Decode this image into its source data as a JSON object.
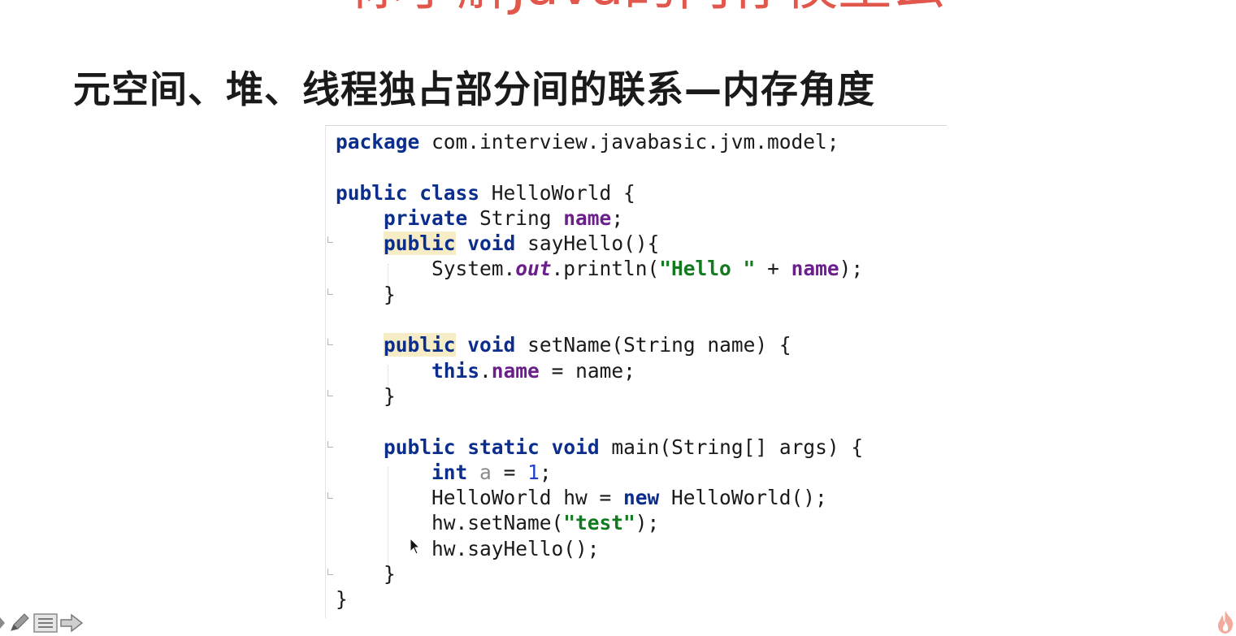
{
  "slide": {
    "title": "你了解Java的内存模型么",
    "subtitle": "元空间、堆、线程独占部分间的联系—内存角度"
  },
  "code": {
    "lines": [
      [
        {
          "t": "package",
          "c": "kw"
        },
        {
          "t": " com.interview.javabasic.jvm.model;"
        }
      ],
      [],
      [
        {
          "t": "public",
          "c": "kw"
        },
        {
          "t": " "
        },
        {
          "t": "class",
          "c": "kw"
        },
        {
          "t": " HelloWorld {"
        }
      ],
      [
        {
          "t": "    "
        },
        {
          "t": "private",
          "c": "kw"
        },
        {
          "t": " String "
        },
        {
          "t": "name",
          "c": "fld"
        },
        {
          "t": ";"
        }
      ],
      [
        {
          "t": "    "
        },
        {
          "t": "public",
          "c": "kwhl"
        },
        {
          "t": " "
        },
        {
          "t": "void",
          "c": "kw"
        },
        {
          "t": " sayHello(){"
        }
      ],
      [
        {
          "t": "        System."
        },
        {
          "t": "out",
          "c": "fldit"
        },
        {
          "t": ".println("
        },
        {
          "t": "\"Hello \"",
          "c": "str"
        },
        {
          "t": " + "
        },
        {
          "t": "name",
          "c": "fld"
        },
        {
          "t": ");"
        }
      ],
      [
        {
          "t": "    }"
        }
      ],
      [],
      [
        {
          "t": "    "
        },
        {
          "t": "public",
          "c": "kwhl"
        },
        {
          "t": " "
        },
        {
          "t": "void",
          "c": "kw"
        },
        {
          "t": " setName(String name) {"
        }
      ],
      [
        {
          "t": "        "
        },
        {
          "t": "this",
          "c": "kw"
        },
        {
          "t": "."
        },
        {
          "t": "name",
          "c": "fld"
        },
        {
          "t": " = name;"
        }
      ],
      [
        {
          "t": "    }"
        }
      ],
      [],
      [
        {
          "t": "    "
        },
        {
          "t": "public",
          "c": "kw"
        },
        {
          "t": " "
        },
        {
          "t": "static",
          "c": "kw"
        },
        {
          "t": " "
        },
        {
          "t": "void",
          "c": "kw"
        },
        {
          "t": " main(String[] args) {"
        }
      ],
      [
        {
          "t": "        "
        },
        {
          "t": "int",
          "c": "kw"
        },
        {
          "t": " "
        },
        {
          "t": "a",
          "c": "unused"
        },
        {
          "t": " = "
        },
        {
          "t": "1",
          "c": "num"
        },
        {
          "t": ";"
        }
      ],
      [
        {
          "t": "        HelloWorld hw = "
        },
        {
          "t": "new",
          "c": "kw"
        },
        {
          "t": " HelloWorld();"
        }
      ],
      [
        {
          "t": "        hw.setName("
        },
        {
          "t": "\"test\"",
          "c": "str"
        },
        {
          "t": ");"
        }
      ],
      [
        {
          "t": "        hw.sayHello();"
        }
      ],
      [
        {
          "t": "    }"
        }
      ],
      [
        {
          "t": "}"
        }
      ]
    ],
    "colors": {
      "keyword": "#0b2d8c",
      "field": "#6a1f8a",
      "string": "#127a1f",
      "number": "#1f3fcc",
      "keyword_highlight_bg": "#f6edc6"
    }
  },
  "toolbar": {
    "icons": [
      "pen-icon",
      "slides-menu-icon",
      "next-arrow-icon"
    ]
  },
  "colors": {
    "title": "#e2574c",
    "subtitle": "#1a1a1a"
  }
}
